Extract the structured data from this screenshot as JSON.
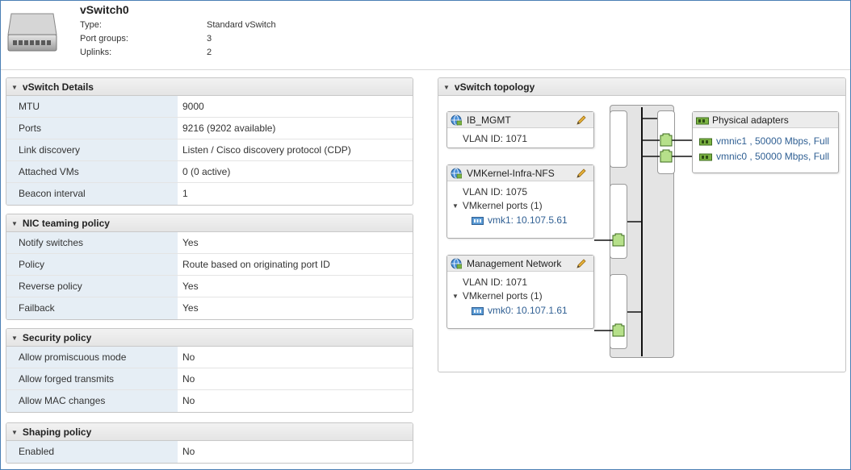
{
  "header": {
    "title": "vSwitch0",
    "rows": [
      {
        "label": "Type:",
        "value": "Standard vSwitch"
      },
      {
        "label": "Port groups:",
        "value": "3"
      },
      {
        "label": "Uplinks:",
        "value": "2"
      }
    ]
  },
  "details": {
    "title": "vSwitch Details",
    "rows": [
      {
        "label": "MTU",
        "value": "9000"
      },
      {
        "label": "Ports",
        "value": "9216 (9202 available)"
      },
      {
        "label": "Link discovery",
        "value": "Listen / Cisco discovery protocol (CDP)"
      },
      {
        "label": "Attached VMs",
        "value": "0 (0 active)"
      },
      {
        "label": "Beacon interval",
        "value": "1"
      }
    ]
  },
  "nic": {
    "title": "NIC teaming policy",
    "rows": [
      {
        "label": "Notify switches",
        "value": "Yes"
      },
      {
        "label": "Policy",
        "value": "Route based on originating port ID"
      },
      {
        "label": "Reverse policy",
        "value": "Yes"
      },
      {
        "label": "Failback",
        "value": "Yes"
      }
    ]
  },
  "security": {
    "title": "Security policy",
    "rows": [
      {
        "label": "Allow promiscuous mode",
        "value": "No"
      },
      {
        "label": "Allow forged transmits",
        "value": "No"
      },
      {
        "label": "Allow MAC changes",
        "value": "No"
      }
    ]
  },
  "shaping": {
    "title": "Shaping policy",
    "rows": [
      {
        "label": "Enabled",
        "value": "No"
      }
    ]
  },
  "topology": {
    "title": "vSwitch topology",
    "portgroups": [
      {
        "name": "IB_MGMT",
        "vlan": "VLAN ID: 1071"
      },
      {
        "name": "VMKernel-Infra-NFS",
        "vlan": "VLAN ID: 1075",
        "ports_label": "VMkernel ports (1)",
        "vmk": "vmk1: 10.107.5.61"
      },
      {
        "name": "Management Network",
        "vlan": "VLAN ID: 1071",
        "ports_label": "VMkernel ports (1)",
        "vmk": "vmk0: 10.107.1.61"
      }
    ],
    "adapters": {
      "title": "Physical adapters",
      "items": [
        "vmnic1 , 50000 Mbps, Full",
        "vmnic0 , 50000 Mbps, Full"
      ]
    }
  },
  "colors": {
    "key_bg": "#e6eef5",
    "link": "#2f5f93",
    "port_green": "#b6e08a",
    "frame_border": "#4a7fb5"
  }
}
